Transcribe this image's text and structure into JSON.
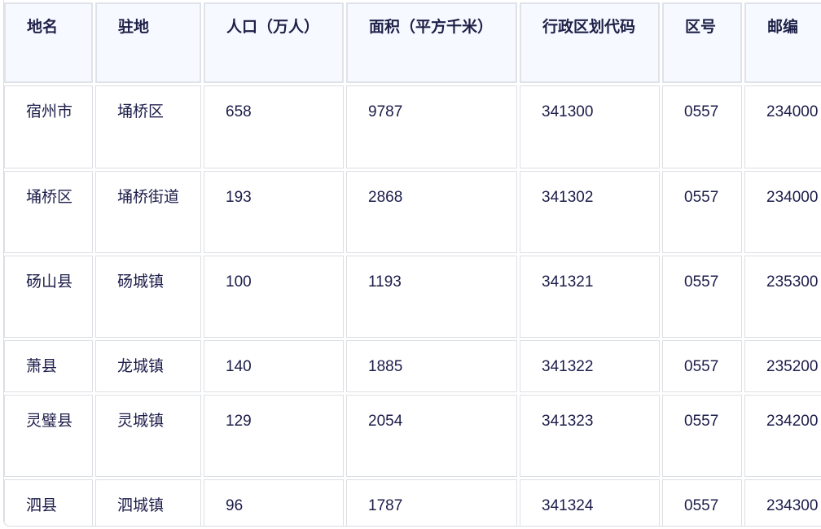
{
  "table": {
    "headers": [
      "地名",
      "驻地",
      "人口（万人）",
      "面积（平方千米）",
      "行政区划代码",
      "区号",
      "邮编"
    ],
    "rows": [
      [
        "宿州市",
        "埇桥区",
        "658",
        "9787",
        "341300",
        "0557",
        "234000"
      ],
      [
        "埇桥区",
        "埇桥街道",
        "193",
        "2868",
        "341302",
        "0557",
        "234000"
      ],
      [
        "砀山县",
        "砀城镇",
        "100",
        "1193",
        "341321",
        "0557",
        "235300"
      ],
      [
        "萧县",
        "龙城镇",
        "140",
        "1885",
        "341322",
        "0557",
        "235200"
      ],
      [
        "灵璧县",
        "灵城镇",
        "129",
        "2054",
        "341323",
        "0557",
        "234200"
      ],
      [
        "泗县",
        "泗城镇",
        "96",
        "1787",
        "341324",
        "0557",
        "234300"
      ]
    ]
  }
}
